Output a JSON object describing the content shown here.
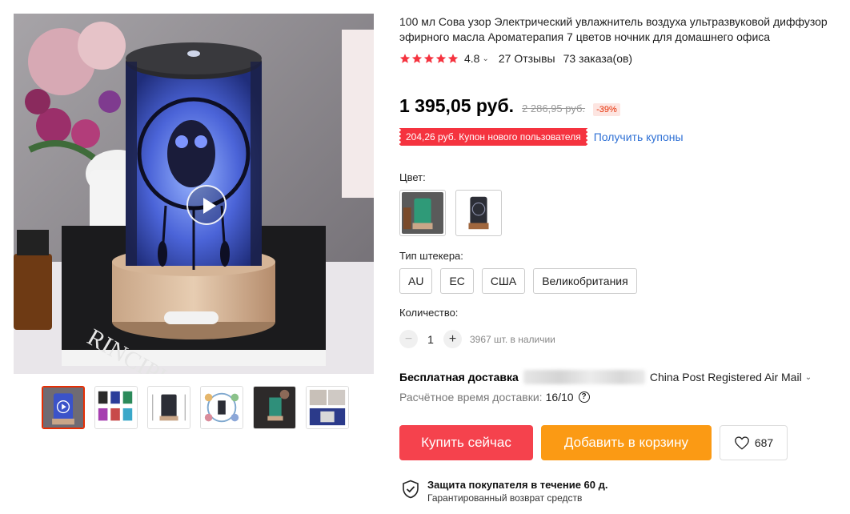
{
  "product": {
    "title": "100 мл Сова узор Электрический увлажнитель воздуха ультразвуковой диффузор эфирного масла Ароматерапия 7 цветов ночник для домашнего офиса"
  },
  "gallery": {
    "thumbnail_count": 6,
    "active_thumbnail": 0
  },
  "rating": {
    "stars": 5,
    "value": "4.8",
    "reviews": "27 Отзывы",
    "orders": "73 заказа(ов)",
    "star_color": "#f5333f"
  },
  "price": {
    "current": "1 395,05 руб.",
    "original": "2 286,95 руб.",
    "discount": "-39%"
  },
  "coupon": {
    "text": "204,26 руб. Купон нового пользователя",
    "link": "Получить купоны"
  },
  "color": {
    "label": "Цвет:",
    "options": [
      "green-diffuser",
      "owl-diffuser"
    ]
  },
  "plug": {
    "label": "Тип штекера:",
    "options": [
      "AU",
      "EC",
      "США",
      "Великобритания"
    ]
  },
  "quantity": {
    "label": "Количество:",
    "minus": "−",
    "value": "1",
    "plus": "+",
    "stock": "3967 шт. в наличии"
  },
  "shipping": {
    "free": "Бесплатная доставка",
    "method": "China Post Registered Air Mail",
    "estimate_label": "Расчётное время доставки:",
    "estimate_value": "16/10",
    "help": "?"
  },
  "actions": {
    "buy_now": "Купить сейчас",
    "add_to_cart": "Добавить в корзину",
    "wishlist_count": "687",
    "buy_color": "#f5424d",
    "cart_color": "#fb9a14"
  },
  "protection": {
    "title": "Защита покупателя в течение 60 д.",
    "subtitle": "Гарантированный возврат средств"
  }
}
